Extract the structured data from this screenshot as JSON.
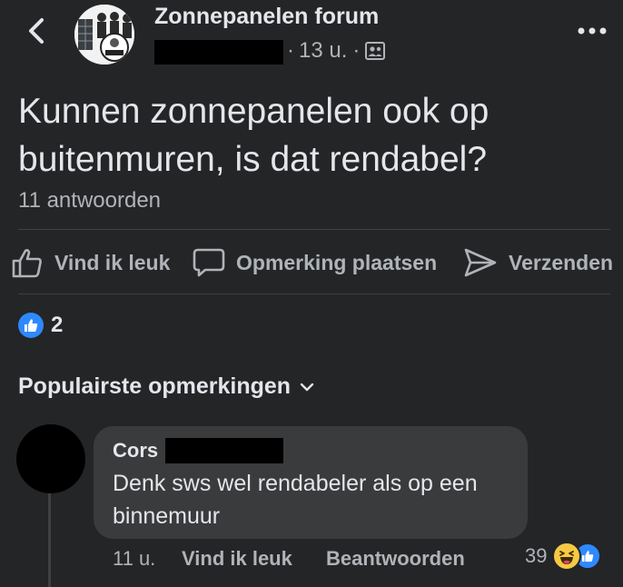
{
  "header": {
    "group_name": "Zonnepanelen forum",
    "time_ago": "13 u.",
    "separator": "·",
    "audience_icon": "group-icon",
    "back_icon": "chevron-left-icon",
    "more_icon": "more-dots-icon"
  },
  "post": {
    "title": "Kunnen zonnepanelen ook op buitenmuren, is dat rendabel?",
    "reply_count_label": "11 antwoorden"
  },
  "actions": [
    {
      "label": "Vind ik leuk",
      "icon": "thumbs-up-icon"
    },
    {
      "label": "Opmerking plaatsen",
      "icon": "comment-icon"
    },
    {
      "label": "Verzenden",
      "icon": "send-icon"
    }
  ],
  "reactions": {
    "count": "2",
    "icon": "like-badge-icon"
  },
  "comments_section": {
    "sort_label": "Populairste opmerkingen",
    "sort_icon": "chevron-down-icon"
  },
  "comment": {
    "author": "Cors",
    "text": "Denk sws wel rendabeler als op een binnemuur",
    "time_ago": "11 u.",
    "like_label": "Vind ik leuk",
    "reply_label": "Beantwoorden",
    "reaction_count": "39",
    "reaction_icons": [
      "haha-emoji-icon",
      "like-badge-icon"
    ]
  },
  "colors": {
    "background": "#242526",
    "text_primary": "#e4e6eb",
    "text_secondary": "#b0b3b8",
    "bubble": "#3a3b3c",
    "accent_blue": "#2e89ff",
    "haha_yellow": "#f7c843"
  }
}
